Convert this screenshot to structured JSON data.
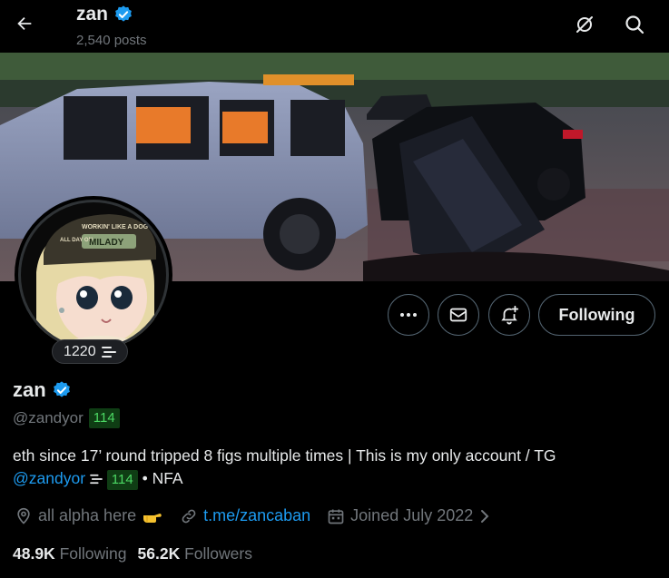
{
  "header": {
    "name": "zan",
    "posts_count": "2,540 posts"
  },
  "avatar": {
    "cap_text_1": "WORKIN' LIKE A DOG",
    "cap_text_2": "ALL DAY ON",
    "cap_text_3": "MILADY",
    "badge_number": "1220"
  },
  "actions": {
    "following_label": "Following"
  },
  "profile": {
    "name": "zan",
    "handle": "@zandyor",
    "handle_badge": "114",
    "bio_text": "eth since 17’ round tripped 8 figs multiple times | This is my only account / TG",
    "bio_mention": "@zandyor",
    "bio_badge": "114",
    "bio_suffix": "• NFA",
    "location": "all alpha here",
    "website": "t.me/zancaban",
    "joined": "Joined July 2022",
    "following_count": "48.9K",
    "following_label": "Following",
    "followers_count": "56.2K",
    "followers_label": "Followers"
  },
  "colors": {
    "verified": "#1d9bf0",
    "link": "#1d9bf0",
    "badge_bg": "#0f3d14",
    "badge_fg": "#4cd964"
  },
  "icons": [
    "back-arrow-icon",
    "verified-icon",
    "no-signal-icon",
    "search-icon",
    "more-icon",
    "mail-icon",
    "notification-plus-icon",
    "location-icon",
    "link-icon",
    "calendar-icon",
    "chevron-right-icon",
    "pointing-hand-icon",
    "stack-icon"
  ]
}
